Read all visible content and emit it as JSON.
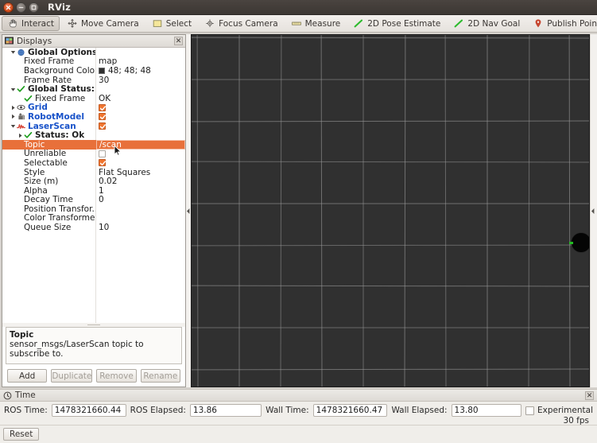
{
  "window": {
    "title": "RViz",
    "close_icon": "close-icon",
    "minimize_icon": "minimize-icon",
    "maximize_icon": "maximize-icon"
  },
  "toolbar": {
    "buttons": [
      {
        "label": "Interact",
        "icon": "hand-cursor-icon",
        "active": true
      },
      {
        "label": "Move Camera",
        "icon": "move-camera-icon",
        "active": false
      },
      {
        "label": "Select",
        "icon": "select-rectangle-icon",
        "active": false
      },
      {
        "label": "Focus Camera",
        "icon": "focus-camera-icon",
        "active": false
      },
      {
        "label": "Measure",
        "icon": "measure-icon",
        "active": false
      },
      {
        "label": "2D Pose Estimate",
        "icon": "pose-estimate-arrow-icon",
        "active": false
      },
      {
        "label": "2D Nav Goal",
        "icon": "nav-goal-arrow-icon",
        "active": false
      },
      {
        "label": "Publish Point",
        "icon": "map-pin-icon",
        "active": false
      }
    ],
    "plus_icon": "plus-icon",
    "minus_icon": "minus-icon",
    "overflow_icon": "chevron-down-icon"
  },
  "displays_panel": {
    "title": "Displays",
    "panel_icon": "displays-icon",
    "close_icon": "close-icon",
    "rows": [
      {
        "name": "Global Options",
        "value": "",
        "indent": 0,
        "expander": "down",
        "icon": "gear-globe-icon",
        "style": "bold",
        "value_type": "text"
      },
      {
        "name": "Fixed Frame",
        "value": "map",
        "indent": 1,
        "expander": "none",
        "icon": "",
        "style": "plain",
        "value_type": "text"
      },
      {
        "name": "Background Color",
        "value": "48; 48; 48",
        "indent": 1,
        "expander": "none",
        "icon": "",
        "style": "plain",
        "value_type": "color",
        "color": "#303030"
      },
      {
        "name": "Frame Rate",
        "value": "30",
        "indent": 1,
        "expander": "none",
        "icon": "",
        "style": "plain",
        "value_type": "text"
      },
      {
        "name": "Global Status: Ok",
        "value": "",
        "indent": 0,
        "expander": "down",
        "icon": "check-green-icon",
        "style": "bold",
        "value_type": "text"
      },
      {
        "name": "Fixed Frame",
        "value": "OK",
        "indent": 1,
        "expander": "none",
        "icon": "check-green-icon",
        "style": "plain",
        "value_type": "text"
      },
      {
        "name": "Grid",
        "value": "",
        "indent": 0,
        "expander": "right",
        "icon": "grid-icon",
        "style": "link",
        "value_type": "checkbox",
        "checked": true
      },
      {
        "name": "RobotModel",
        "value": "",
        "indent": 0,
        "expander": "right",
        "icon": "robot-model-icon",
        "style": "link",
        "value_type": "checkbox",
        "checked": true
      },
      {
        "name": "LaserScan",
        "value": "",
        "indent": 0,
        "expander": "down",
        "icon": "laserscan-icon",
        "style": "link",
        "value_type": "checkbox",
        "checked": true
      },
      {
        "name": "Status: Ok",
        "value": "",
        "indent": 1,
        "expander": "right",
        "icon": "check-green-icon",
        "style": "bold",
        "value_type": "text"
      },
      {
        "name": "Topic",
        "value": "/scan",
        "indent": 1,
        "expander": "none",
        "icon": "",
        "style": "plain",
        "value_type": "text",
        "selected": true
      },
      {
        "name": "Unreliable",
        "value": "",
        "indent": 1,
        "expander": "none",
        "icon": "",
        "style": "plain",
        "value_type": "checkbox",
        "checked": false
      },
      {
        "name": "Selectable",
        "value": "",
        "indent": 1,
        "expander": "none",
        "icon": "",
        "style": "plain",
        "value_type": "checkbox",
        "checked": true
      },
      {
        "name": "Style",
        "value": "Flat Squares",
        "indent": 1,
        "expander": "none",
        "icon": "",
        "style": "plain",
        "value_type": "text"
      },
      {
        "name": "Size (m)",
        "value": "0.02",
        "indent": 1,
        "expander": "none",
        "icon": "",
        "style": "plain",
        "value_type": "text"
      },
      {
        "name": "Alpha",
        "value": "1",
        "indent": 1,
        "expander": "none",
        "icon": "",
        "style": "plain",
        "value_type": "text"
      },
      {
        "name": "Decay Time",
        "value": "0",
        "indent": 1,
        "expander": "none",
        "icon": "",
        "style": "plain",
        "value_type": "text"
      },
      {
        "name": "Position Transfor...",
        "value": "",
        "indent": 1,
        "expander": "none",
        "icon": "",
        "style": "plain",
        "value_type": "text"
      },
      {
        "name": "Color Transformer",
        "value": "",
        "indent": 1,
        "expander": "none",
        "icon": "",
        "style": "plain",
        "value_type": "text"
      },
      {
        "name": "Queue Size",
        "value": "10",
        "indent": 1,
        "expander": "none",
        "icon": "",
        "style": "plain",
        "value_type": "text"
      }
    ],
    "description": {
      "title": "Topic",
      "text": "sensor_msgs/LaserScan topic to subscribe to."
    },
    "buttons": [
      {
        "label": "Add",
        "enabled": true
      },
      {
        "label": "Duplicate",
        "enabled": false
      },
      {
        "label": "Remove",
        "enabled": false
      },
      {
        "label": "Rename",
        "enabled": false
      }
    ]
  },
  "viewport": {
    "background_color": "#303030",
    "grid_color": "#9a9a9a",
    "robot_color": "#050505",
    "marker_color": "#22bb22",
    "splitter_left_icon": "splitter-handle-icon",
    "splitter_right_icon": "collapse-arrow-icon"
  },
  "time_panel": {
    "title": "Time",
    "clock_icon": "clock-icon",
    "close_icon": "close-icon",
    "fields": [
      {
        "label": "ROS Time:",
        "value": "1478321660.44"
      },
      {
        "label": "ROS Elapsed:",
        "value": "13.86"
      },
      {
        "label": "Wall Time:",
        "value": "1478321660.47"
      },
      {
        "label": "Wall Elapsed:",
        "value": "13.80"
      }
    ],
    "experimental": {
      "label": "Experimental",
      "checked": false
    }
  },
  "status_bar": {
    "fps": "30 fps",
    "reset_label": "Reset"
  }
}
